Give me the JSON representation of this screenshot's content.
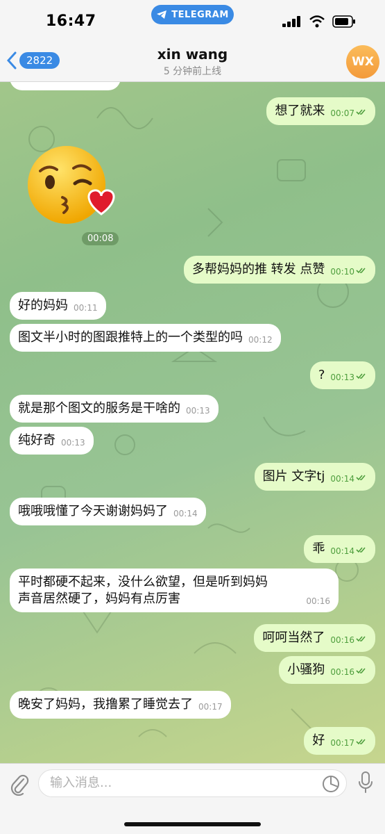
{
  "status_bar": {
    "time": "16:47",
    "app_pill": "TELEGRAM"
  },
  "header": {
    "back_count": "2822",
    "contact_name": "xin wang",
    "last_seen": "5 分钟前上线",
    "avatar_initials": "WX"
  },
  "messages": [
    {
      "dir": "out",
      "text": "想了就来",
      "time": "00:07"
    },
    {
      "dir": "in",
      "type": "sticker",
      "emoji": "😘",
      "time": "00:08"
    },
    {
      "dir": "out",
      "text": "多帮妈妈的推 转发 点赞",
      "time": "00:10"
    },
    {
      "dir": "in",
      "text": "好的妈妈",
      "time": "00:11"
    },
    {
      "dir": "in",
      "text": "图文半小时的图跟推特上的一个类型的吗",
      "time": "00:12"
    },
    {
      "dir": "out",
      "text": "?",
      "time": "00:13"
    },
    {
      "dir": "in",
      "text": "就是那个图文的服务是干啥的",
      "time": "00:13"
    },
    {
      "dir": "in",
      "text": "纯好奇",
      "time": "00:13"
    },
    {
      "dir": "out",
      "text": "图片 文字tj",
      "time": "00:14"
    },
    {
      "dir": "in",
      "text": "哦哦哦懂了今天谢谢妈妈了",
      "time": "00:14"
    },
    {
      "dir": "out",
      "text": "乖",
      "time": "00:14"
    },
    {
      "dir": "in",
      "line1": "平时都硬不起来，没什么欲望，但是听到妈妈",
      "line2": "声音居然硬了，妈妈有点厉害",
      "time": "00:16"
    },
    {
      "dir": "out",
      "text": "呵呵当然了",
      "time": "00:16"
    },
    {
      "dir": "out",
      "text": "小骚狗",
      "time": "00:16"
    },
    {
      "dir": "in",
      "text": "晚安了妈妈，我撸累了睡觉去了",
      "time": "00:17"
    },
    {
      "dir": "out",
      "text": "好",
      "time": "00:17"
    }
  ],
  "input": {
    "placeholder": "输入消息..."
  },
  "colors": {
    "accent": "#3a8ae4",
    "outgoing_bubble": "#e5fbc8",
    "incoming_bubble": "#ffffff",
    "read_check": "#4e9e3d"
  },
  "icons": [
    "telegram-plane-icon",
    "signal-icon",
    "wifi-icon",
    "battery-icon",
    "chevron-left-icon",
    "paperclip-icon",
    "sticker-icon",
    "microphone-icon",
    "double-check-icon"
  ]
}
